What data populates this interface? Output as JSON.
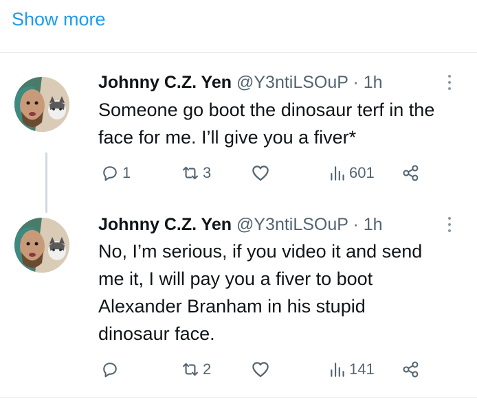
{
  "show_more": "Show more",
  "tweets": [
    {
      "name": "Johnny C.Z. Yen",
      "handle": "@Y3ntiLSOuP",
      "separator": "·",
      "time": "1h",
      "text_lines": [
        "Someone go boot the dinosaur terf in the",
        "face for me. I’ll give you a fiver*"
      ],
      "reply_count": "1",
      "retweet_count": "3",
      "like_count": "",
      "view_count": "601"
    },
    {
      "name": "Johnny C.Z. Yen",
      "handle": "@Y3ntiLSOuP",
      "separator": "·",
      "time": "1h",
      "text_lines": [
        "No, I’m serious, if you video it and send",
        "me it, I will pay you a fiver to boot",
        "Alexander Branham in his stupid",
        "dinosaur face."
      ],
      "reply_count": "",
      "retweet_count": "2",
      "like_count": "",
      "view_count": "141"
    }
  ],
  "colors": {
    "accent": "#1d9bf0",
    "secondary_text": "#536471",
    "divider": "#e6ecf0"
  }
}
